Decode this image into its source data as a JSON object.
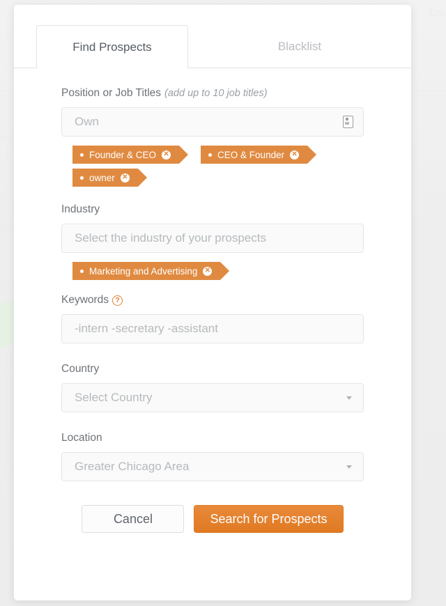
{
  "background": {
    "faint_text_top_right": "Em",
    "faint_text_left": "OR L"
  },
  "modal": {
    "tabs": [
      {
        "label": "Find Prospects",
        "active": true
      },
      {
        "label": "Blacklist",
        "active": false
      }
    ],
    "fields": {
      "position": {
        "label": "Position or Job Titles",
        "hint": "(add up to 10 job titles)",
        "input_value": "Own",
        "placeholder": "Own",
        "trailing_icon": "id-card-icon",
        "tags": [
          "Founder & CEO",
          "CEO & Founder",
          "owner"
        ]
      },
      "industry": {
        "label": "Industry",
        "placeholder": "Select the industry of your prospects",
        "tags": [
          "Marketing and Advertising"
        ]
      },
      "keywords": {
        "label": "Keywords",
        "help_icon": "question-mark-icon",
        "help_glyph": "?",
        "placeholder": "-intern -secretary -assistant"
      },
      "country": {
        "label": "Country",
        "selected": "Select Country",
        "caret_icon": "chevron-down-icon"
      },
      "location": {
        "label": "Location",
        "selected": "Greater Chicago Area",
        "caret_icon": "chevron-down-icon"
      }
    },
    "footer": {
      "cancel_label": "Cancel",
      "submit_label": "Search for Prospects"
    }
  },
  "colors": {
    "accent_orange": "#e08a41",
    "primary_button": "#e07a22",
    "tab_active_text": "#555b62",
    "tab_inactive_text": "#b9bcc0",
    "placeholder_text": "#b6babd",
    "label_text": "#6d7277",
    "input_background": "#fafafa",
    "border": "#e6e6e6"
  }
}
